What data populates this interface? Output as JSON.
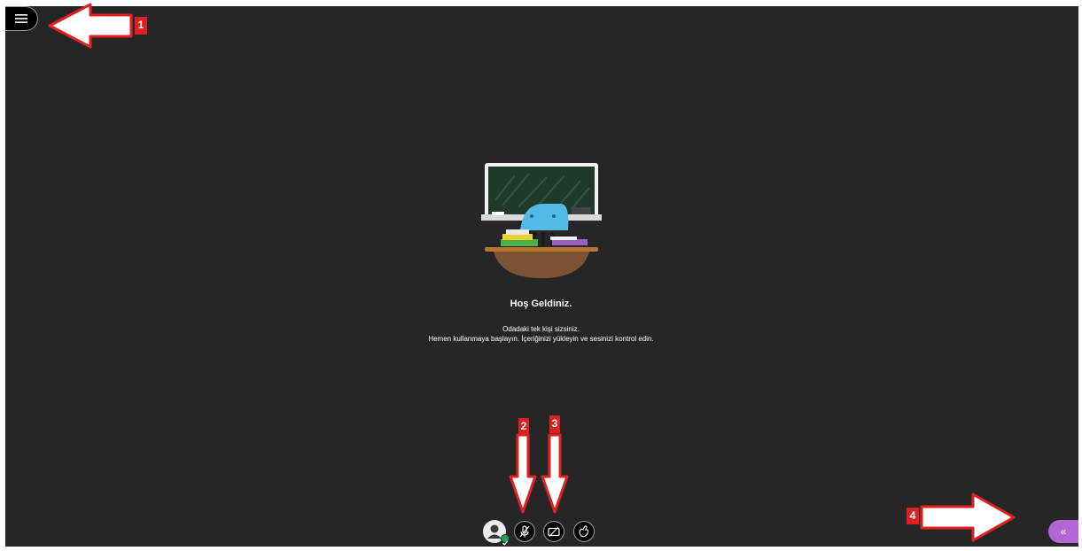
{
  "welcome": {
    "title": "Hoş Geldiniz.",
    "line1": "Odadaki tek kişi sizsiniz.",
    "line2": "Hemen kullanmaya başlayın. İçeriğinizi yükleyin ve sesinizi kontrol edin."
  },
  "annotations": {
    "badge1": "1",
    "badge2": "2",
    "badge3": "3",
    "badge4": "4"
  },
  "controls": {
    "panel_toggle_glyph": "«"
  },
  "icons": {
    "menu": "hamburger-menu-icon",
    "avatar": "user-avatar-icon",
    "status": "check-status-icon",
    "microphone": "microphone-muted-icon",
    "camera": "camera-off-icon",
    "hand": "raise-hand-icon",
    "panel": "double-chevron-left-icon"
  },
  "colors": {
    "stage_background": "#262626",
    "accent_purple": "#b266d6",
    "status_green": "#18a55a",
    "annotation_red": "#e02020"
  }
}
